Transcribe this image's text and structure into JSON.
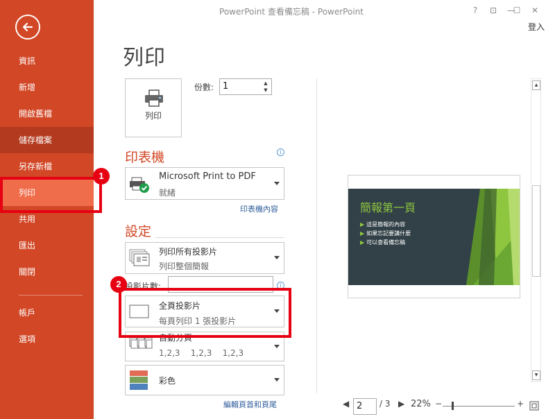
{
  "window": {
    "title": "PowerPoint 查看備忘稿 - PowerPoint",
    "help": "?",
    "restore": "⊡",
    "minimize": "—",
    "maximize": "☐",
    "close": "✕",
    "sign_in": "登入"
  },
  "sidebar": {
    "items": [
      {
        "label": "資訊"
      },
      {
        "label": "新增"
      },
      {
        "label": "開啟舊檔"
      },
      {
        "label": "儲存檔案"
      },
      {
        "label": "另存新檔"
      },
      {
        "label": "列印"
      },
      {
        "label": "共用"
      },
      {
        "label": "匯出"
      },
      {
        "label": "關閉"
      },
      {
        "label": "帳戶"
      },
      {
        "label": "選項"
      }
    ],
    "active": "列印"
  },
  "main": {
    "title": "列印",
    "print_button": "列印",
    "copies_label": "份數:",
    "copies_value": "1",
    "printer_heading": "印表機",
    "printer": {
      "name": "Microsoft Print to PDF",
      "status": "就緒"
    },
    "printer_properties_link": "印表機內容",
    "settings_heading": "設定",
    "slides_range": {
      "main": "列印所有投影片",
      "sub": "列印整個簡報"
    },
    "slides_label": "投影片數:",
    "layout": {
      "main": "全頁投影片",
      "sub": "每頁列印 1 張投影片"
    },
    "collation": {
      "main": "自動分頁",
      "sub": "1,2,3    1,2,3    1,2,3"
    },
    "color": {
      "main": "彩色"
    },
    "header_footer_link": "編輯頁首和頁尾"
  },
  "preview": {
    "slide_title": "簡報第一頁",
    "bullets": [
      "這是簡報的內容",
      "如果忘記要講什麼",
      "可以查看備忘稿"
    ],
    "page_current": "2",
    "page_total": "/ 3",
    "zoom": "22%",
    "zoom_minus": "−",
    "zoom_plus": "+"
  },
  "annotations": {
    "badge1": "1",
    "badge2": "2"
  },
  "colors": {
    "sidebar": "#d24726",
    "accent": "#d24726",
    "highlight": "#e60012",
    "slide_bg": "#324147",
    "slide_green": "#8ec63f"
  }
}
